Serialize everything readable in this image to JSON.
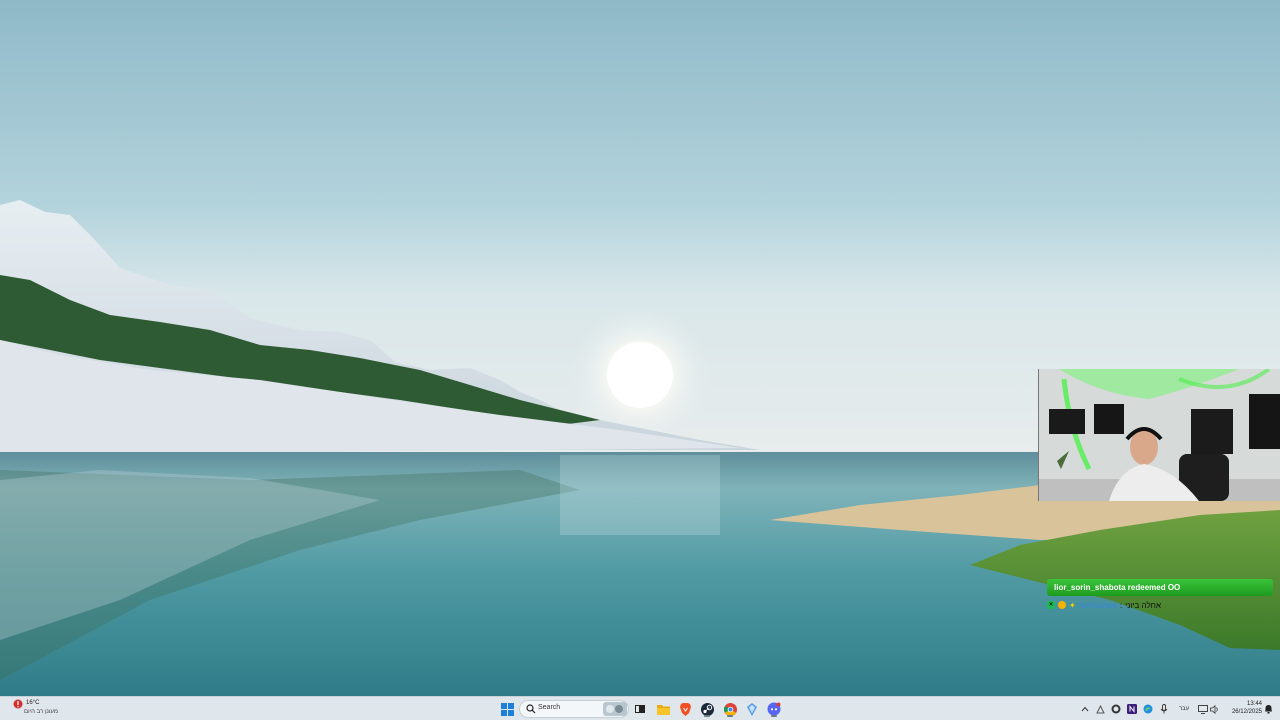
{
  "stream_chat": {
    "redemption_text": "lior_sorin_shabota redeemed OO",
    "message": {
      "username": "NetGames",
      "separator": ":",
      "text": "אחלה ביוני"
    }
  },
  "taskbar": {
    "weather": {
      "temperature": "16°C",
      "description": "מעונן רב היום"
    },
    "search": {
      "placeholder": "Search"
    },
    "pinned_apps": [
      "start-icon",
      "task-view-icon",
      "file-explorer-icon",
      "brave-browser-icon",
      "steam-icon",
      "chrome-icon",
      "copilot-icon",
      "discord-icon"
    ],
    "tray": {
      "keyboard_language": "עבר",
      "time": "13:44",
      "date": "26/12/2025"
    }
  },
  "colors": {
    "taskbar_bg": "#dfe6ec",
    "redeem_green": "#2db32d",
    "chat_username": "#3a86d9"
  }
}
